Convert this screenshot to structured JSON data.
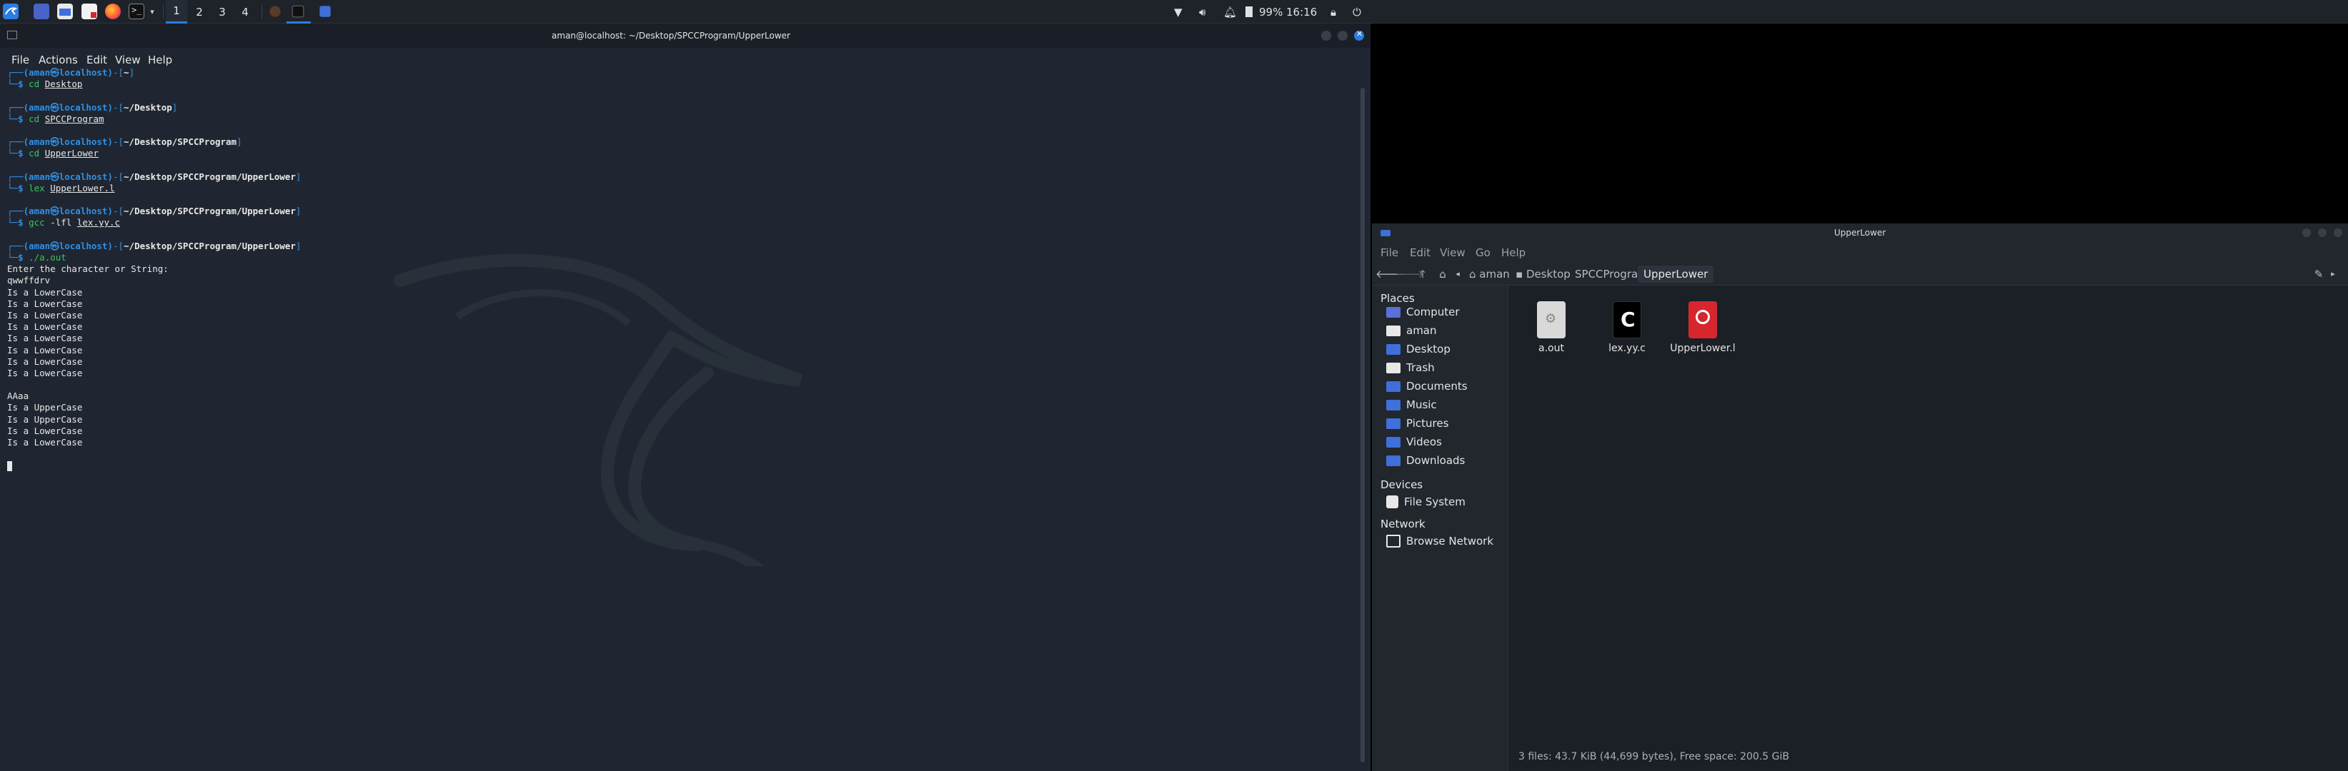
{
  "top_panel": {
    "launchers": [
      "kali-menu-icon",
      "workspace-switcher-icon",
      "file-manager-icon",
      "text-editor-icon",
      "firefox-icon",
      "terminal-icon"
    ],
    "workspaces": [
      "1",
      "2",
      "3",
      "4"
    ],
    "active_workspace": "1",
    "tray": {
      "battery": "99%",
      "time": "16:16"
    }
  },
  "terminal": {
    "title": "aman@localhost: ~/Desktop/SPCCProgram/UpperLower",
    "menu": [
      "File",
      "Actions",
      "Edit",
      "View",
      "Help"
    ],
    "prompt": {
      "user_host": "(aman㉿localhost)",
      "dollar": "$"
    },
    "blocks": [
      {
        "path": "~",
        "cmd": "cd",
        "arg": "Desktop"
      },
      {
        "path": "~/Desktop",
        "cmd": "cd",
        "arg": "SPCCProgram"
      },
      {
        "path": "~/Desktop/SPCCProgram",
        "cmd": "cd",
        "arg": "UpperLower"
      },
      {
        "path": "~/Desktop/SPCCProgram/UpperLower",
        "cmd": "lex",
        "arg": "UpperLower.l"
      },
      {
        "path": "~/Desktop/SPCCProgram/UpperLower",
        "cmd": "gcc",
        "flag": "-lfl",
        "arg": "lex.yy.c"
      },
      {
        "path": "~/Desktop/SPCCProgram/UpperLower",
        "cmd": "./a.out",
        "arg": ""
      }
    ],
    "output": [
      "Enter the character or String:",
      "qwwffdrv",
      "Is a LowerCase",
      "Is a LowerCase",
      "Is a LowerCase",
      "Is a LowerCase",
      "Is a LowerCase",
      "Is a LowerCase",
      "Is a LowerCase",
      "Is a LowerCase",
      "",
      "AAaa",
      "Is a UpperCase",
      "Is a UpperCase",
      "Is a LowerCase",
      "Is a LowerCase",
      ""
    ]
  },
  "file_manager": {
    "title": "UpperLower",
    "menu": [
      "File",
      "Edit",
      "View",
      "Go",
      "Help"
    ],
    "breadcrumbs": [
      "aman",
      "Desktop",
      "SPCCProgram",
      "UpperLower"
    ],
    "sidebar": {
      "places_header": "Places",
      "places": [
        {
          "label": "Computer",
          "icon": "computer-icon",
          "color": "#5b6fd6"
        },
        {
          "label": "aman",
          "icon": "home-folder-icon",
          "color": "#e8e8e8"
        },
        {
          "label": "Desktop",
          "icon": "desktop-folder-icon",
          "color": "#3f6fd8"
        },
        {
          "label": "Trash",
          "icon": "trash-icon",
          "color": "#e8e8e8"
        },
        {
          "label": "Documents",
          "icon": "documents-folder-icon",
          "color": "#3f6fd8"
        },
        {
          "label": "Music",
          "icon": "music-folder-icon",
          "color": "#3f6fd8"
        },
        {
          "label": "Pictures",
          "icon": "pictures-folder-icon",
          "color": "#3f6fd8"
        },
        {
          "label": "Videos",
          "icon": "videos-folder-icon",
          "color": "#3f6fd8"
        },
        {
          "label": "Downloads",
          "icon": "downloads-folder-icon",
          "color": "#3f6fd8"
        }
      ],
      "devices_header": "Devices",
      "devices": [
        {
          "label": "File System",
          "icon": "drive-icon",
          "color": "#e8e8e8"
        }
      ],
      "network_header": "Network",
      "network": [
        {
          "label": "Browse Network",
          "icon": "network-icon",
          "color": "#e8e8e8"
        }
      ]
    },
    "files": [
      {
        "name": "a.out",
        "icon": "executable-file-icon",
        "color": "#d9d9d9"
      },
      {
        "name": "lex.yy.c",
        "icon": "c-source-file-icon",
        "color": "#000000"
      },
      {
        "name": "UpperLower.l",
        "icon": "lex-file-icon",
        "color": "#d7262e"
      }
    ],
    "status": "3 files: 43.7 KiB (44,699 bytes), Free space: 200.5 GiB"
  }
}
